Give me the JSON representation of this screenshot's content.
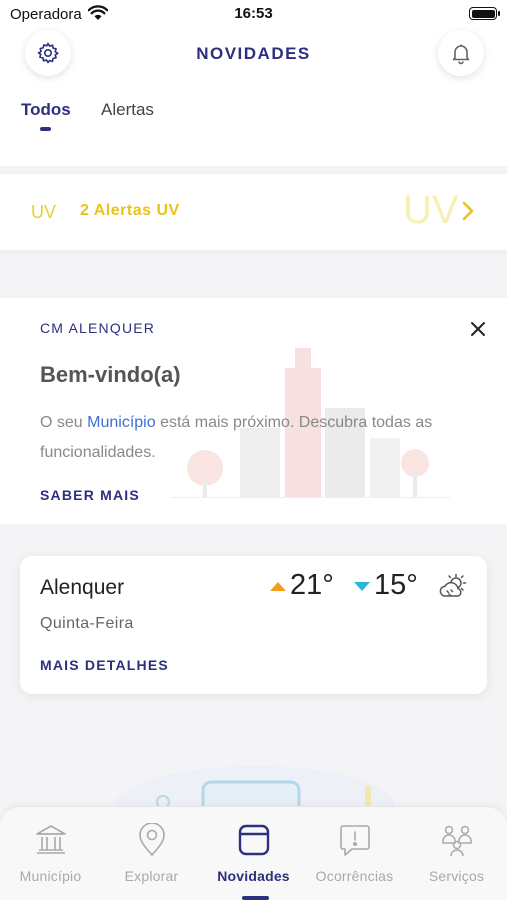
{
  "status_bar": {
    "carrier": "Operadora",
    "time": "16:53"
  },
  "header": {
    "title": "NOVIDADES",
    "settings_icon": "gear-icon",
    "notifications_icon": "bell-icon",
    "tabs": [
      {
        "label": "Todos",
        "active": true
      },
      {
        "label": "Alertas",
        "active": false
      }
    ]
  },
  "uv_alert": {
    "icon_text": "UV",
    "label": "2 Alertas UV",
    "watermark": "UV",
    "color": "#e8c41a"
  },
  "welcome_card": {
    "org": "CM ALENQUER",
    "title": "Bem-vindo(a)",
    "body_before": "O seu ",
    "body_link": "Município",
    "body_after": " está mais próximo. Descubra todas as funcionalidades.",
    "cta": "SABER MAIS"
  },
  "weather": {
    "city": "Alenquer",
    "day": "Quinta-Feira",
    "max_temp": "21°",
    "min_temp": "15°",
    "condition_icon": "partly-cloudy-icon",
    "cta": "MAIS DETALHES"
  },
  "tab_bar": {
    "items": [
      {
        "label": "Município",
        "icon": "building-icon",
        "active": false
      },
      {
        "label": "Explorar",
        "icon": "map-pin-icon",
        "active": false
      },
      {
        "label": "Novidades",
        "icon": "news-icon",
        "active": true
      },
      {
        "label": "Ocorrências",
        "icon": "alert-bubble-icon",
        "active": false
      },
      {
        "label": "Serviços",
        "icon": "services-icon",
        "active": false
      }
    ]
  },
  "colors": {
    "primary": "#2d2f7f",
    "accent_uv": "#e8c41a",
    "temp_up": "#f2a21a",
    "temp_down": "#2bb5d9"
  }
}
